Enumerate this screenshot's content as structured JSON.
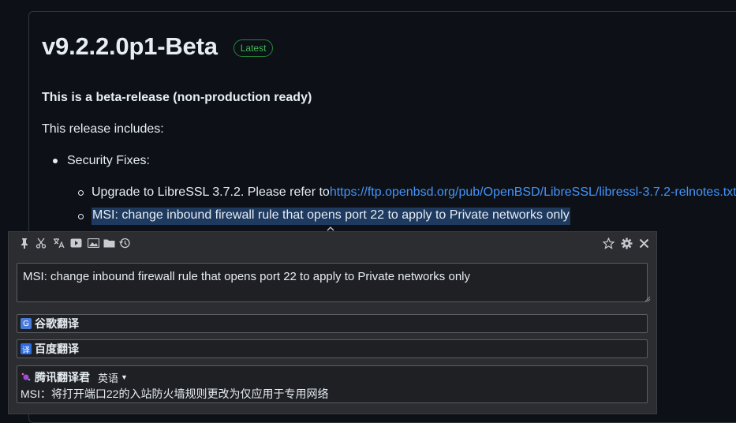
{
  "release": {
    "title": "v9.2.2.0p1-Beta",
    "badge": "Latest",
    "beta_note": "This is a beta-release (non-production ready)",
    "includes": "This release includes:",
    "section": "Security Fixes:",
    "item1_text": "Upgrade to LibreSSL 3.7.2. Please refer to ",
    "item1_link": "https://ftp.openbsd.org/pub/OpenBSD/LibreSSL/libressl-3.7.2-relnotes.txt",
    "item2_text": "MSI: change inbound firewall rule that opens port 22 to apply to Private networks only"
  },
  "translator": {
    "source_text": "MSI: change inbound firewall rule that opens port 22 to apply to Private networks only",
    "engines": [
      {
        "name": "谷歌翻译",
        "icon": "google-translate-icon",
        "color": "#4a7bd8"
      },
      {
        "name": "百度翻译",
        "icon": "baidu-translate-icon",
        "color": "#2d6cdf"
      },
      {
        "name": "腾讯翻译君",
        "icon": "tencent-translate-icon",
        "color": "#a24bd8",
        "language": "英语",
        "result": "MSI：将打开端口22的入站防火墙规则更改为仅应用于专用网络"
      }
    ],
    "toolbar_icons": [
      "pin-icon",
      "cut-icon",
      "translate-icon",
      "video-icon",
      "image-icon",
      "folder-icon",
      "history-icon"
    ],
    "toolbar_right_icons": [
      "star-icon",
      "gear-icon",
      "close-icon"
    ]
  }
}
